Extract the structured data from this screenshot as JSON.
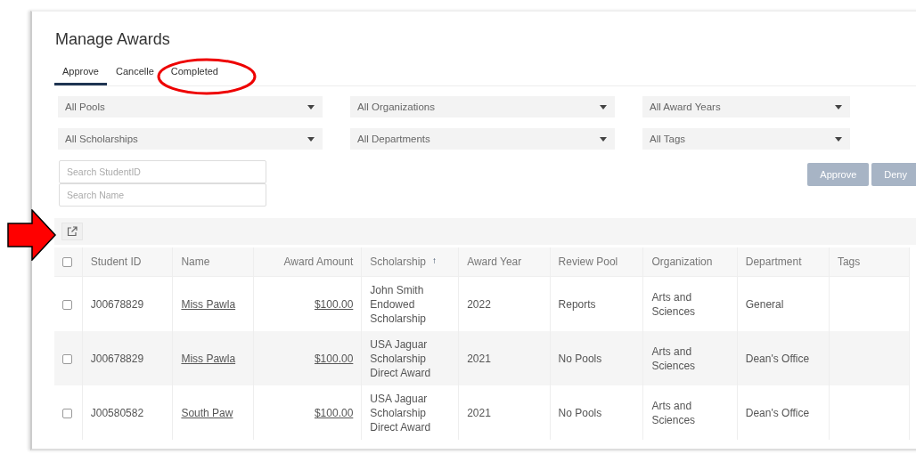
{
  "page": {
    "title": "Manage Awards"
  },
  "tabs": [
    {
      "label": "Approve",
      "selected": true
    },
    {
      "label": "Cancelle",
      "selected": false
    },
    {
      "label": "Completed",
      "selected": false
    }
  ],
  "filters": [
    {
      "value": "All Pools"
    },
    {
      "value": "All Organizations"
    },
    {
      "value": "All Award Years"
    },
    {
      "value": "All Scholarships"
    },
    {
      "value": "All Departments"
    },
    {
      "value": "All Tags"
    }
  ],
  "search": [
    {
      "placeholder": "Search StudentID"
    },
    {
      "placeholder": "Search Name"
    }
  ],
  "actions": [
    {
      "label": "Approve",
      "disabled": true
    },
    {
      "label": "Deny",
      "disabled": true
    }
  ],
  "table": {
    "select_all": {
      "checked": false
    },
    "columns": [
      {
        "label": "Student ID",
        "numeric": false
      },
      {
        "label": "Name",
        "numeric": false
      },
      {
        "label": "Award Amount",
        "numeric": true
      },
      {
        "label": "Scholarship",
        "numeric": false,
        "sort_mark": "↑"
      },
      {
        "label": "Award Year",
        "numeric": false
      },
      {
        "label": "Review Pool",
        "numeric": false
      },
      {
        "label": "Organization",
        "numeric": false
      },
      {
        "label": "Department",
        "numeric": false
      },
      {
        "label": "Tags",
        "numeric": false
      }
    ],
    "rows": [
      {
        "checked": false,
        "cells": [
          "J00678829",
          "Miss Pawla",
          "$100.00",
          "John Smith Endowed Scholarship",
          "2022",
          "Reports",
          "Arts and Sciences",
          "General",
          ""
        ]
      },
      {
        "checked": false,
        "cells": [
          "J00678829",
          "Miss Pawla",
          "$100.00",
          "USA Jaguar Scholarship Direct Award",
          "2021",
          "No Pools",
          "Arts and Sciences",
          "Dean's Office",
          ""
        ]
      },
      {
        "checked": false,
        "cells": [
          "J00580582",
          "South Paw",
          "$100.00",
          "USA Jaguar Scholarship Direct Award",
          "2021",
          "No Pools",
          "Arts and Sciences",
          "Dean's Office",
          ""
        ]
      }
    ]
  }
}
